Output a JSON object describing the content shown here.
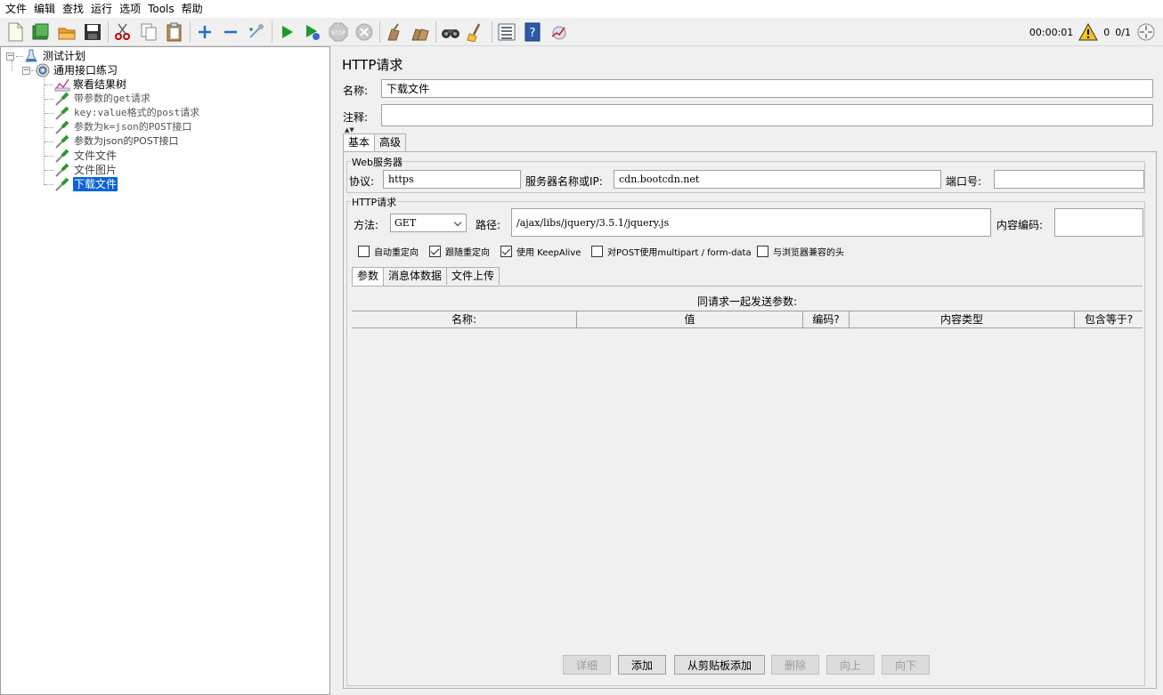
{
  "menubar": {
    "items": [
      "文件",
      "编辑",
      "查找",
      "运行",
      "选项",
      "Tools",
      "帮助"
    ]
  },
  "toolbar": {
    "elapsed_time": "00:00:01",
    "warning_count": "0",
    "threads": "0/1",
    "icons": [
      "new-icon",
      "templates-icon",
      "open-icon",
      "save-icon",
      "cut-icon",
      "copy-icon",
      "paste-icon",
      "expand-icon",
      "collapse-icon",
      "toggle-icon",
      "start-icon",
      "start-no-pause-icon",
      "stop-icon",
      "shutdown-icon",
      "clear-icon",
      "clear-all-icon",
      "search-icon",
      "reset-search-icon",
      "function-helper-icon",
      "help-icon",
      "remote-icon"
    ]
  },
  "tree": {
    "items": [
      {
        "label": "测试计划",
        "type": "test-plan"
      },
      {
        "label": "通用接口练习",
        "type": "thread-group"
      },
      {
        "label": "察看结果树",
        "type": "listener"
      },
      {
        "label": "带参数的get请求",
        "type": "sampler"
      },
      {
        "label": "key:value格式的post请求",
        "type": "sampler"
      },
      {
        "label": "参数为k=json的POST接口",
        "type": "sampler"
      },
      {
        "label": "参数为json的POST接口",
        "type": "sampler"
      },
      {
        "label": "文件文件",
        "type": "sampler"
      },
      {
        "label": "文件图片",
        "type": "sampler"
      },
      {
        "label": "下载文件",
        "type": "sampler",
        "selected": true
      }
    ]
  },
  "form": {
    "title": "HTTP请求",
    "name_label": "名称:",
    "name_value": "下载文件",
    "comment_label": "注释:",
    "comment_value": "",
    "tabs": [
      "基本",
      "高级"
    ],
    "web_server": {
      "group_title": "Web服务器",
      "protocol_label": "协议:",
      "protocol_value": "https",
      "server_label": "服务器名称或IP:",
      "server_value": "cdn.bootcdn.net",
      "port_label": "端口号:",
      "port_value": ""
    },
    "http_request": {
      "group_title": "HTTP请求",
      "method_label": "方法:",
      "method_value": "GET",
      "path_label": "路径:",
      "path_value": "/ajax/libs/jquery/3.5.1/jquery.js",
      "encoding_label": "内容编码:",
      "encoding_value": ""
    },
    "checkboxes": [
      {
        "label": "自动重定向",
        "checked": false
      },
      {
        "label": "跟随重定向",
        "checked": true
      },
      {
        "label": "使用 KeepAlive",
        "checked": true
      },
      {
        "label": "对POST使用multipart / form-data",
        "checked": false
      },
      {
        "label": "与浏览器兼容的头",
        "checked": false
      }
    ],
    "sub_tabs": [
      "参数",
      "消息体数据",
      "文件上传"
    ],
    "params_caption": "同请求一起发送参数:",
    "table_headers": [
      "名称:",
      "值",
      "编码?",
      "内容类型",
      "包含等于?"
    ],
    "buttons": [
      {
        "label": "详细",
        "enabled": false
      },
      {
        "label": "添加",
        "enabled": true
      },
      {
        "label": "从剪贴板添加",
        "enabled": true
      },
      {
        "label": "删除",
        "enabled": false
      },
      {
        "label": "向上",
        "enabled": false
      },
      {
        "label": "向下",
        "enabled": false
      }
    ]
  },
  "colors": {
    "selection": "#0a64d8",
    "background": "#f0f0f0"
  }
}
